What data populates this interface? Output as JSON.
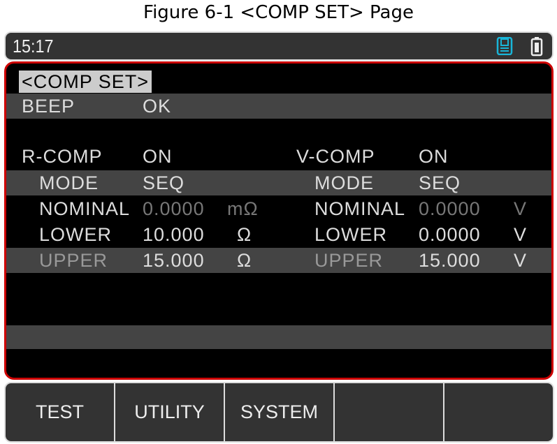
{
  "caption": "Figure 6-1   <COMP SET> Page",
  "status": {
    "time": "15:17",
    "icons": [
      "save-disk-icon",
      "battery-icon"
    ],
    "accent": "#19b5d8"
  },
  "page_title": "<COMP SET>",
  "beep": {
    "label": "BEEP",
    "value": "OK"
  },
  "r_comp": {
    "label": "R-COMP",
    "value": "ON",
    "mode": {
      "label": "MODE",
      "value": "SEQ"
    },
    "nominal": {
      "label": "NOMINAL",
      "value": "0.0000",
      "unit": "mΩ"
    },
    "lower": {
      "label": "LOWER",
      "value": "10.000",
      "unit": "Ω"
    },
    "upper": {
      "label": "UPPER",
      "value": "15.000",
      "unit": "Ω"
    }
  },
  "v_comp": {
    "label": "V-COMP",
    "value": "ON",
    "mode": {
      "label": "MODE",
      "value": "SEQ"
    },
    "nominal": {
      "label": "NOMINAL",
      "value": "0.0000",
      "unit": "V"
    },
    "lower": {
      "label": "LOWER",
      "value": "0.0000",
      "unit": "V"
    },
    "upper": {
      "label": "UPPER",
      "value": "15.000",
      "unit": "V"
    }
  },
  "softkeys": [
    "TEST",
    "UTILITY",
    "SYSTEM",
    "",
    ""
  ]
}
